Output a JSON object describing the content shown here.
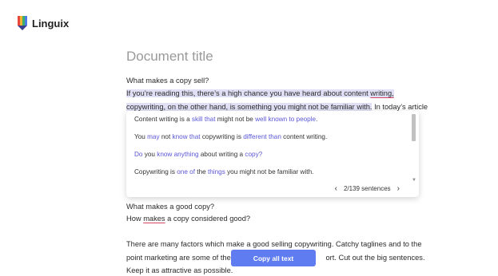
{
  "app": {
    "name": "Linguix"
  },
  "document": {
    "title": "Document title",
    "heading1": "What makes a copy sell?",
    "line2_a": "If you’re reading this, there’s a high chance you have heard about content ",
    "line2_b": "writing,",
    "line3_a": "copywriting, on the other hand, is something you might not be familiar with.",
    "line3_b": " In today’s article",
    "heading2": "What makes a good copy?",
    "line5_a": "How ",
    "line5_b": "makes",
    "line5_c": " a copy considered good?",
    "para_line1": "There are many factors which make a good selling copywriting. Catchy taglines and to the",
    "para_line2_a": "point marketing are some of them",
    "para_line2_b": "ort. Cut out the big sentences.",
    "para_line3": "Keep it as attractive as possible."
  },
  "suggestions": [
    {
      "parts": [
        "Content writing is a ",
        "skill that",
        " might not be ",
        "well known to people",
        "."
      ]
    },
    {
      "parts": [
        "You ",
        "may",
        " not ",
        "know that",
        " copywriting is ",
        "different than",
        " content writing."
      ]
    },
    {
      "parts": [
        "",
        "Do",
        " you ",
        "know anything",
        " about writing a ",
        "copy?",
        ""
      ]
    },
    {
      "parts": [
        "Copywriting is ",
        "one of",
        " the ",
        "things",
        " you might not be familiar with."
      ]
    }
  ],
  "pager": {
    "label": "2/139 sentences"
  },
  "copy_button": {
    "label": "Copy all text"
  },
  "colors": {
    "accent": "#5f7df0",
    "highlight": "#dfe0f5",
    "change": "#5b57d6",
    "error": "#d64561"
  }
}
